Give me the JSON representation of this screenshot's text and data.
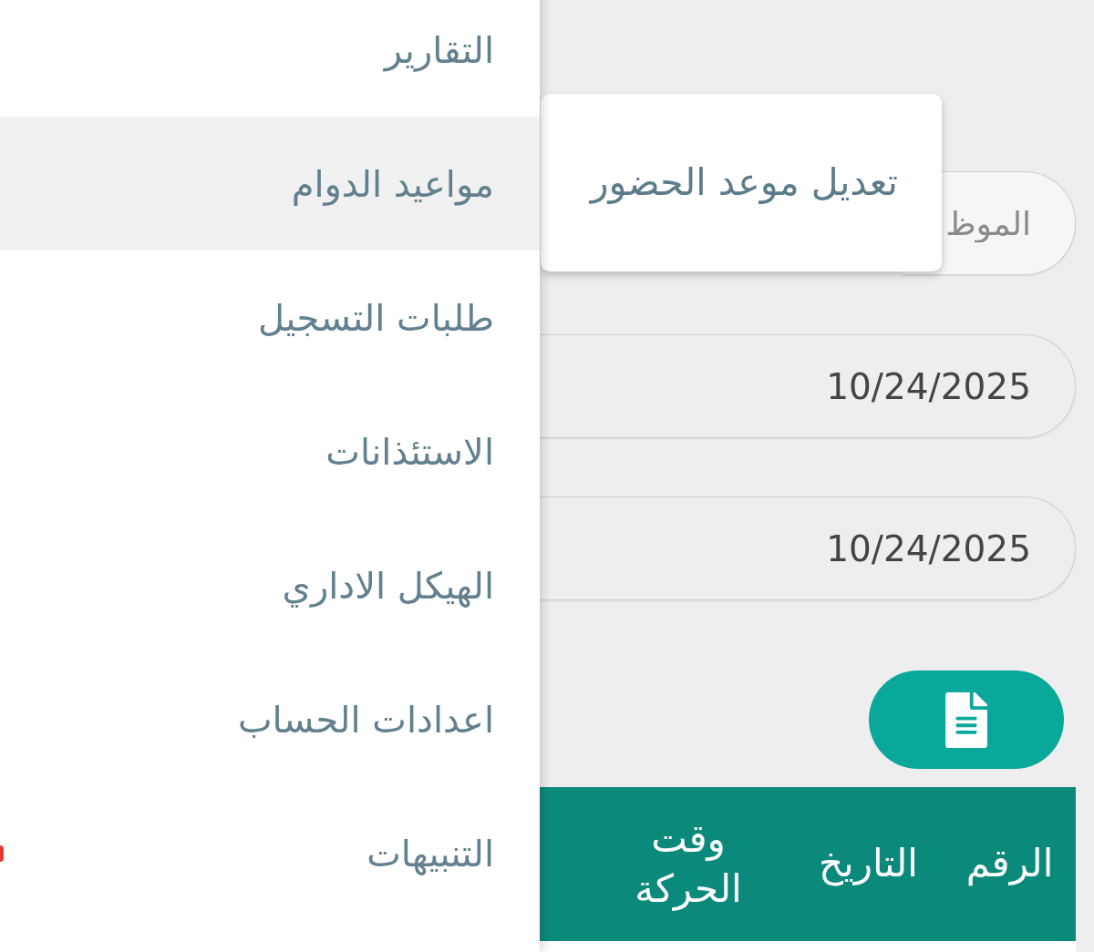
{
  "drawer": {
    "items": [
      {
        "label": "التقارير",
        "selected": false,
        "has_badge": false
      },
      {
        "label": "مواعيد الدوام",
        "selected": true,
        "has_badge": false
      },
      {
        "label": "طلبات التسجيل",
        "selected": false,
        "has_badge": false
      },
      {
        "label": "الاستئذانات",
        "selected": false,
        "has_badge": false
      },
      {
        "label": "الهيكل الاداري",
        "selected": false,
        "has_badge": false
      },
      {
        "label": "اعدادات الحساب",
        "selected": false,
        "has_badge": false
      },
      {
        "label": "التنبيهات",
        "selected": false,
        "has_badge": true
      }
    ]
  },
  "popup_menu": {
    "items": [
      {
        "label": "تعديل موعد الحضور"
      }
    ]
  },
  "fields": [
    {
      "placeholder": "الموظ"
    },
    {
      "value": "10/24/2025"
    },
    {
      "value": "10/24/2025"
    }
  ],
  "table": {
    "columns": [
      "الرقم",
      "التاريخ",
      "وقت الحركة"
    ]
  }
}
